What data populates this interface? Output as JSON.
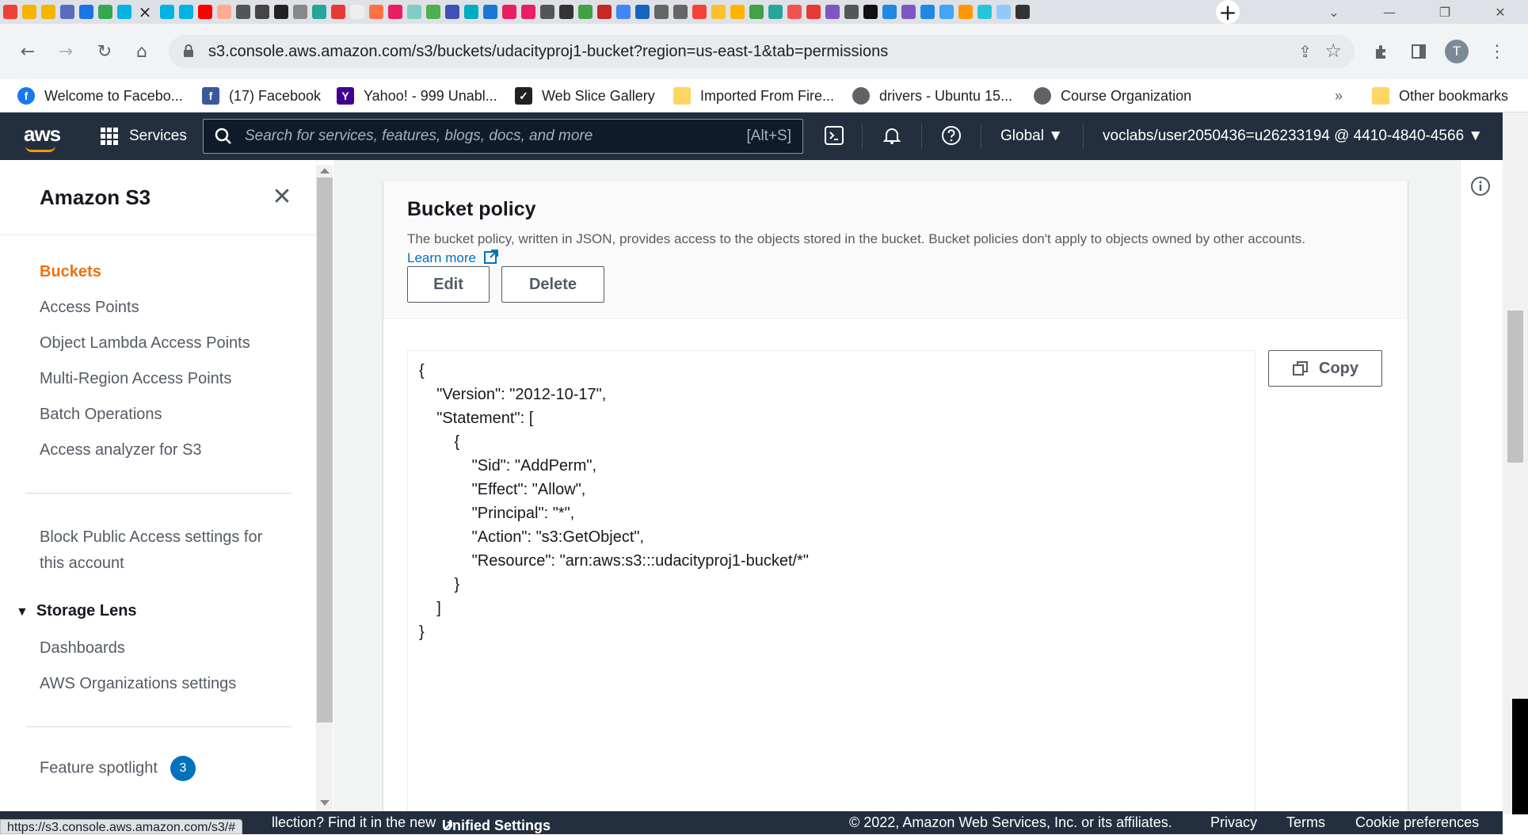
{
  "browser": {
    "url": "s3.console.aws.amazon.com/s3/buckets/udacityproj1-bucket?region=us-east-1&tab=permissions",
    "profile_initial": "T",
    "bookmarks": [
      {
        "label": "Welcome to Facebo..."
      },
      {
        "label": "(17) Facebook"
      },
      {
        "label": "Yahoo! - 999 Unabl..."
      },
      {
        "label": "Web Slice Gallery"
      },
      {
        "label": "Imported From Fire..."
      },
      {
        "label": "drivers - Ubuntu 15..."
      },
      {
        "label": "Course Organization"
      }
    ],
    "overflow_label": "»",
    "other_bookmarks": "Other bookmarks",
    "status_url": "https://s3.console.aws.amazon.com/s3/#"
  },
  "aws": {
    "logo": "aws",
    "services_label": "Services",
    "search_placeholder": "Search for services, features, blogs, docs, and more",
    "search_shortcut": "[Alt+S]",
    "region": "Global ▼",
    "account": "voclabs/user2050436=u26233194 @ 4410-4840-4566 ▼"
  },
  "sidebar": {
    "title": "Amazon S3",
    "items": [
      {
        "label": "Buckets"
      },
      {
        "label": "Access Points"
      },
      {
        "label": "Object Lambda Access Points"
      },
      {
        "label": "Multi-Region Access Points"
      },
      {
        "label": "Batch Operations"
      },
      {
        "label": "Access analyzer for S3"
      }
    ],
    "block_public_1": "Block Public Access settings for",
    "block_public_2": "this account",
    "storage_lens": "Storage Lens",
    "storage_lens_items": [
      {
        "label": "Dashboards"
      },
      {
        "label": "AWS Organizations settings"
      }
    ],
    "feature_spotlight": "Feature spotlight",
    "feature_spotlight_count": "3"
  },
  "policy": {
    "title": "Bucket policy",
    "description": "The bucket policy, written in JSON, provides access to the objects stored in the bucket. Bucket policies don't apply to objects owned by other accounts.",
    "learn_more": "Learn more",
    "edit_label": "Edit",
    "delete_label": "Delete",
    "copy_label": "Copy",
    "json": "{\n    \"Version\": \"2012-10-17\",\n    \"Statement\": [\n        {\n            \"Sid\": \"AddPerm\",\n            \"Effect\": \"Allow\",\n            \"Principal\": \"*\",\n            \"Action\": \"s3:GetObject\",\n            \"Resource\": \"arn:aws:s3:::udacityproj1-bucket/*\"\n        }\n    ]\n}"
  },
  "footer": {
    "feedback_fragment": "llection? Find it in the new",
    "unified_settings": "Unified Settings",
    "copyright": "© 2022, Amazon Web Services, Inc. or its affiliates.",
    "privacy": "Privacy",
    "terms": "Terms",
    "cookie": "Cookie preferences"
  },
  "colors": {
    "aws_nav": "#232f3e",
    "aws_orange": "#ec7211",
    "link_blue": "#0073bb"
  }
}
